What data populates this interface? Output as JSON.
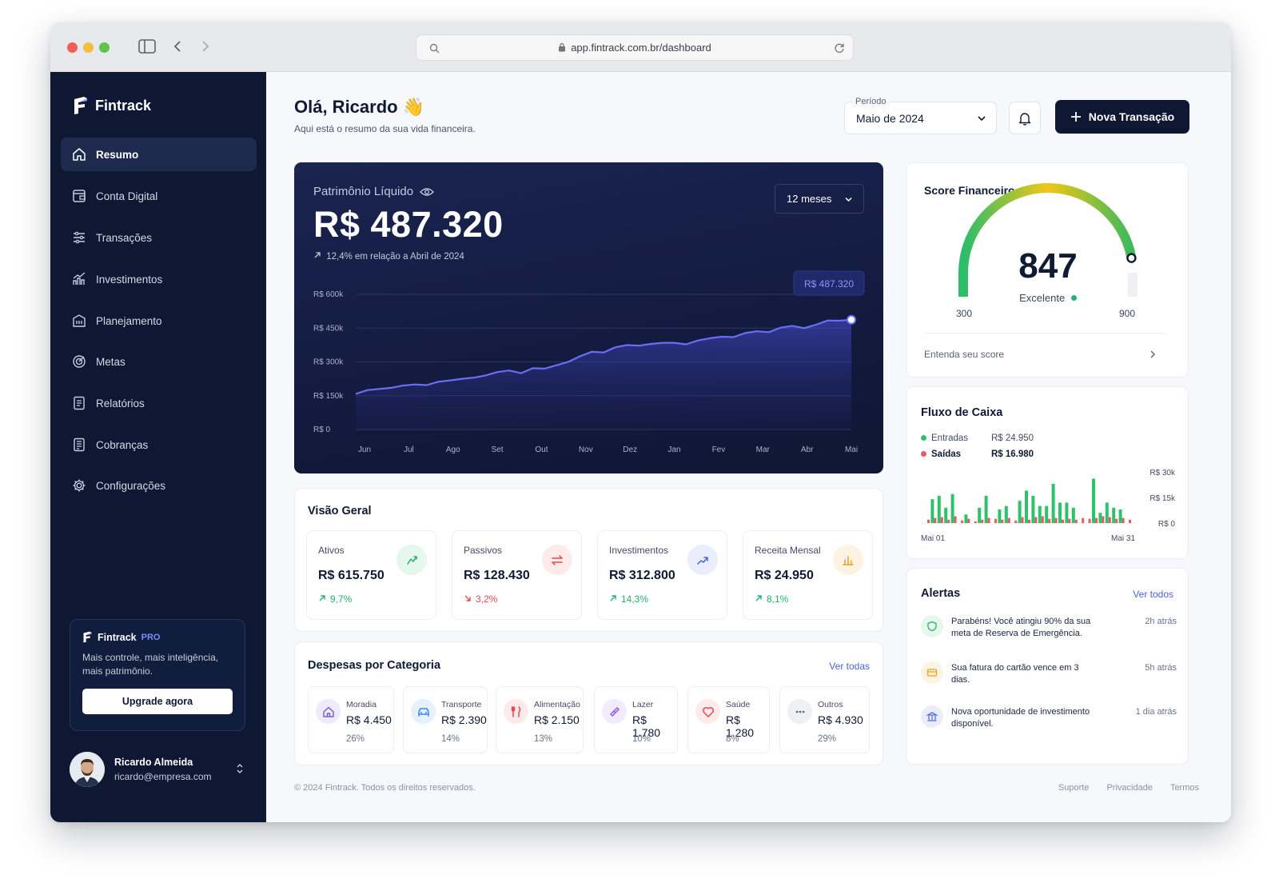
{
  "browser": {
    "url": "app.fintrack.com.br/dashboard"
  },
  "sidebar": {
    "brand": "Fintrack",
    "items": [
      {
        "label": "Resumo",
        "icon": "home-icon",
        "active": true
      },
      {
        "label": "Conta Digital",
        "icon": "wallet-icon"
      },
      {
        "label": "Transações",
        "icon": "sliders-icon"
      },
      {
        "label": "Investimentos",
        "icon": "growth-chart-icon"
      },
      {
        "label": "Planejamento",
        "icon": "building-icon"
      },
      {
        "label": "Metas",
        "icon": "target-icon"
      },
      {
        "label": "Relatórios",
        "icon": "report-icon"
      },
      {
        "label": "Cobranças",
        "icon": "invoice-icon"
      },
      {
        "label": "Configurações",
        "icon": "gear-icon"
      }
    ],
    "pro": {
      "brand": "Fintrack",
      "tag": "PRO",
      "text": "Mais controle, mais inteligência, mais patrimônio.",
      "button": "Upgrade agora"
    },
    "user": {
      "name": "Ricardo Almeida",
      "email": "ricardo@empresa.com"
    }
  },
  "header": {
    "greeting": "Olá, Ricardo 👋",
    "subtitle": "Aqui está o resumo da sua vida financeira.",
    "period_label": "Período",
    "period_value": "Maio de 2024",
    "new_transaction": "Nova Transação"
  },
  "net_worth": {
    "title": "Patrimônio Líquido",
    "value": "R$ 487.320",
    "change": "12,4% em relação a Abril de 2024",
    "range": "12 meses",
    "tooltip": "R$ 487.320"
  },
  "chart_data": {
    "type": "area",
    "x": [
      "Jun",
      "Jul",
      "Ago",
      "Set",
      "Out",
      "Nov",
      "Dez",
      "Jan",
      "Fev",
      "Mar",
      "Abr",
      "Mai"
    ],
    "y_ticks": [
      "R$ 600k",
      "R$ 450k",
      "R$ 300k",
      "R$ 150k",
      "R$ 0"
    ],
    "ylim": [
      0,
      600000
    ],
    "values": [
      158000,
      175000,
      180000,
      185000,
      195000,
      200000,
      197000,
      212000,
      218000,
      225000,
      230000,
      240000,
      255000,
      262000,
      250000,
      272000,
      270000,
      285000,
      300000,
      325000,
      345000,
      342000,
      365000,
      375000,
      372000,
      380000,
      385000,
      385000,
      378000,
      395000,
      405000,
      412000,
      410000,
      428000,
      436000,
      432000,
      452000,
      460000,
      450000,
      465000,
      484000,
      483000,
      487320
    ]
  },
  "score": {
    "title": "Score Financeiro",
    "value": "847",
    "label": "Excelente",
    "min": "300",
    "max": "900",
    "fraction": 0.9,
    "link": "Entenda seu score"
  },
  "cashflow": {
    "title": "Fluxo de Caixa",
    "in_label": "Entradas",
    "in_value": "R$ 24.950",
    "out_label": "Saídas",
    "out_value": "R$ 16.980",
    "y_ticks": [
      "R$ 30k",
      "R$ 15k",
      "R$ 0"
    ],
    "x_start": "Mai 01",
    "x_end": "Mai 31",
    "green": "#2ec26a",
    "red": "#e35d67",
    "entries": [
      0,
      14000,
      16000,
      9000,
      17000,
      0,
      5000,
      0,
      9000,
      16000,
      0,
      8000,
      10000,
      0,
      13000,
      19000,
      16000,
      10000,
      10000,
      23000,
      12000,
      12000,
      9000,
      0,
      0,
      26000,
      6000,
      12000,
      9000,
      8000,
      0
    ],
    "exits": [
      2000,
      3000,
      3500,
      2000,
      4000,
      1500,
      2500,
      1000,
      2000,
      3000,
      2500,
      2000,
      3000,
      1500,
      3500,
      2000,
      3500,
      4000,
      2500,
      3000,
      2000,
      2500,
      2000,
      3000,
      2500,
      3000,
      4000,
      3500,
      2500,
      3000,
      2000
    ]
  },
  "alerts": {
    "title": "Alertas",
    "link": "Ver todos",
    "items": [
      {
        "text": "Parabéns! Você atingiu 90% da sua meta de Reserva de Emergência.",
        "time": "2h atrás",
        "icon": "shield-check-icon"
      },
      {
        "text": "Sua fatura do cartão vence em 3 dias.",
        "time": "5h atrás",
        "icon": "card-icon"
      },
      {
        "text": "Nova oportunidade de investimento disponível.",
        "time": "1 dia atrás",
        "icon": "bank-icon"
      }
    ]
  },
  "overview": {
    "title": "Visão Geral",
    "kpis": [
      {
        "label": "Ativos",
        "value": "R$ 615.750",
        "change": "9,7%",
        "dir": "up",
        "icon": "assets-icon",
        "color": "#22b26b",
        "bg": "#e6f7ee"
      },
      {
        "label": "Passivos",
        "value": "R$ 128.430",
        "change": "3,2%",
        "dir": "down",
        "icon": "transfer-icon",
        "color": "#e5484d",
        "bg": "#fdeaea"
      },
      {
        "label": "Investimentos",
        "value": "R$ 312.800",
        "change": "14,3%",
        "dir": "up",
        "icon": "trend-up-icon",
        "color": "#4a63d6",
        "bg": "#eaeefc"
      },
      {
        "label": "Receita Mensal",
        "value": "R$ 24.950",
        "change": "8,1%",
        "dir": "up",
        "icon": "bar-chart-icon",
        "color": "#f0a020",
        "bg": "#fdf3e2"
      }
    ]
  },
  "expenses": {
    "title": "Despesas por Categoria",
    "link": "Ver todas",
    "items": [
      {
        "name": "Moradia",
        "value": "R$ 4.450",
        "pct": "26%",
        "icon": "house-icon",
        "color": "#7b5cd6",
        "bg": "#efeafb"
      },
      {
        "name": "Transporte",
        "value": "R$ 2.390",
        "pct": "14%",
        "icon": "car-icon",
        "color": "#3b82f6",
        "bg": "#e7f0fd"
      },
      {
        "name": "Alimentação",
        "value": "R$ 2.150",
        "pct": "13%",
        "icon": "cutlery-icon",
        "color": "#e5484d",
        "bg": "#fdeaea"
      },
      {
        "name": "Lazer",
        "value": "R$ 1.780",
        "pct": "10%",
        "icon": "ticket-icon",
        "color": "#8b5cf6",
        "bg": "#f1ebfd"
      },
      {
        "name": "Saúde",
        "value": "R$ 1.280",
        "pct": "8%",
        "icon": "heart-icon",
        "color": "#e5484d",
        "bg": "#fdeaea"
      },
      {
        "name": "Outros",
        "value": "R$ 4.930",
        "pct": "29%",
        "icon": "more-icon",
        "color": "#5a6378",
        "bg": "#eef0f4"
      }
    ]
  },
  "footer": {
    "copyright": "© 2024 Fintrack. Todos os direitos reservados.",
    "links": [
      "Suporte",
      "Privacidade",
      "Termos"
    ]
  }
}
